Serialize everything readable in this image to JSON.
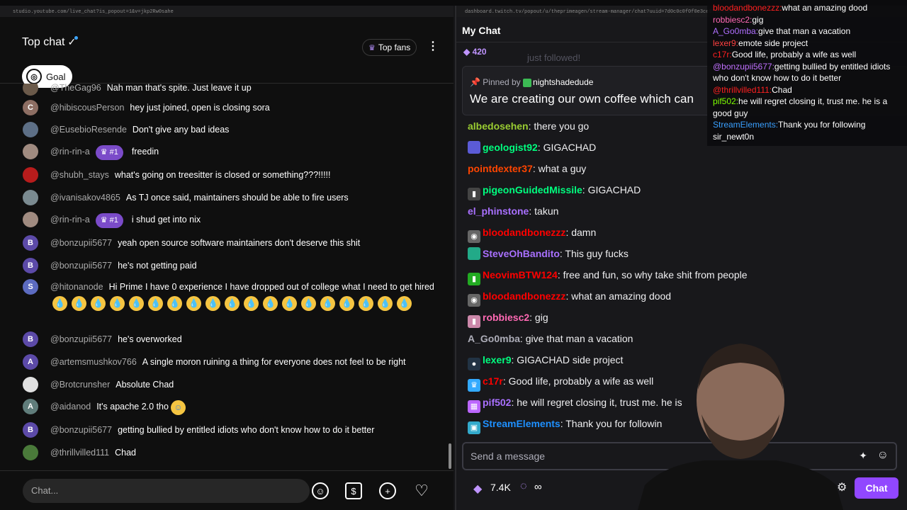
{
  "colors": {
    "yt_bg": "#0f0f0f",
    "twitch_bg": "#18181b",
    "twitch_purple": "#9147ff",
    "yt_badge": "#7b4bc9"
  },
  "youtube": {
    "url": "studio.youtube.com/live_chat?is_popout=1&v=jkp2Rw0sahe",
    "title": "Top chat",
    "top_fans_label": "Top fans",
    "goal_label": "Goal",
    "chat_placeholder": "Chat...",
    "messages": [
      {
        "author": "@TheGag96",
        "text": "Nah man that's spite. Just leave it up",
        "avatar_letter": "",
        "avatar_color": "#6b5a4a"
      },
      {
        "author": "@hibiscousPerson",
        "text": "hey just joined, open is closing sora",
        "avatar_letter": "C",
        "avatar_color": "#8d6e63"
      },
      {
        "author": "@EusebioResende",
        "text": "Don't give any bad ideas",
        "avatar_letter": "",
        "avatar_color": "#5d6f86"
      },
      {
        "author": "@rin-rin-a",
        "badge": "#1",
        "text": "freedin",
        "avatar_letter": "",
        "avatar_color": "#a08b80"
      },
      {
        "author": "@shubh_stays",
        "text": "what's going on treesitter is closed or something???!!!!!",
        "avatar_letter": "",
        "avatar_color": "#b71c1c"
      },
      {
        "author": "@ivanisakov4865",
        "text": "As TJ once said, maintainers should be able to fire users",
        "avatar_letter": "",
        "avatar_color": "#7a8a90"
      },
      {
        "author": "@rin-rin-a",
        "badge": "#1",
        "text": "i shud get into nix",
        "avatar_letter": "",
        "avatar_color": "#a08b80"
      },
      {
        "author": "@bonzupii5677",
        "text": "yeah open source software maintainers don't deserve this shit",
        "avatar_letter": "B",
        "avatar_color": "#5c4aa8"
      },
      {
        "author": "@bonzupii5677",
        "text": "he's not getting paid",
        "avatar_letter": "B",
        "avatar_color": "#5c4aa8"
      },
      {
        "author": "@hitonanode",
        "text": "Hi Prime I have 0 experience I have dropped out of college what I need to get hired",
        "avatar_letter": "S",
        "avatar_color": "#5c6bc0"
      },
      {
        "author": "@bonzupii5677",
        "text": "he's overworked",
        "avatar_letter": "B",
        "avatar_color": "#5c4aa8"
      },
      {
        "author": "@artemsmushkov766",
        "text": "A single moron ruining a thing for everyone does not feel to be right",
        "avatar_letter": "A",
        "avatar_color": "#5c4aa8"
      },
      {
        "author": "@Brotcrunsher",
        "text": "Absolute Chad",
        "avatar_letter": "",
        "avatar_color": "#e0e0e0"
      },
      {
        "author": "@aidanod",
        "text": "It's apache 2.0 tho",
        "avatar_letter": "A",
        "avatar_color": "#607d7b"
      },
      {
        "author": "@bonzupii5677",
        "text": "getting bullied by entitled idiots who don't know how to do it better",
        "avatar_letter": "B",
        "avatar_color": "#5c4aa8"
      },
      {
        "author": "@thrillvilled111",
        "text": "Chad",
        "avatar_letter": "",
        "avatar_color": "#4a7a3a"
      }
    ]
  },
  "twitch": {
    "url": "dashboard.twitch.tv/popout/u/theprimeagen/stream-manager/chat?uuid=7d0c0c0f0f0e3ce0f8d43aa864f7fb05",
    "title": "My Chat",
    "points": "420",
    "followed_text": "just followed!",
    "pinned_by_label": "Pinned by",
    "pinned_by_user": "nightshadedude",
    "pinned_message": "We are creating our own coffee which can",
    "input_placeholder": "Send a message",
    "viewers": "7.4K",
    "infinity": "∞",
    "chat_button": "Chat",
    "messages": [
      {
        "user": "albedosehen",
        "text": ": there you go",
        "color": "#9acd32"
      },
      {
        "user": "geologist92",
        "text": ": GIGACHAD",
        "color": "#00ff7f"
      },
      {
        "user": "pointdexter37",
        "text": ": what a guy",
        "color": "#ff4500"
      },
      {
        "user": "pigeonGuidedMissile",
        "text": ": GIGACHAD",
        "color": "#00ff7f"
      },
      {
        "user": "el_phinstone",
        "text": ": takun",
        "color": "#a970ff"
      },
      {
        "user": "bloodandbonezzz",
        "text": ": damn",
        "color": "#ff0000"
      },
      {
        "user": "SteveOhBandito",
        "text": ": This guy fucks",
        "color": "#a970ff"
      },
      {
        "user": "NeovimBTW124",
        "text": ": free and fun, so why take shit from people",
        "color": "#ff0000"
      },
      {
        "user": "bloodandbonezzz",
        "text": ": what an amazing dood",
        "color": "#ff0000"
      },
      {
        "user": "robbiesc2",
        "text": ": gig",
        "color": "#ff69b4"
      },
      {
        "user": "A_Go0mba",
        "text": ": give that man a vacation",
        "color": "#adadb8"
      },
      {
        "user": "lexer9",
        "text": ": GIGACHAD side project",
        "color": "#00ff7f"
      },
      {
        "user": "c17r",
        "text": ": Good life, probably a wife as well",
        "color": "#ff0000"
      },
      {
        "user": "pif502",
        "text": ": he will regret closing it, trust me. he is",
        "color": "#a970ff"
      },
      {
        "user": "StreamElements",
        "text": ": Thank you for followin",
        "color": "#1e90ff"
      }
    ]
  },
  "overlay": {
    "messages": [
      {
        "user": "bloodandbonezzz:",
        "text": "what an amazing dood",
        "color": "#ff2020"
      },
      {
        "user": "robbiesc2:",
        "text": "gig",
        "color": "#ff69b4"
      },
      {
        "user": "A_Go0mba:",
        "text": "give that man a vacation",
        "color": "#b070ff"
      },
      {
        "user": "lexer9:",
        "text": "emote side project",
        "color": "#ff4040"
      },
      {
        "user": "c17r:",
        "text": "Good life, probably a wife as well",
        "color": "#ff2020"
      },
      {
        "user": "@bonzupii5677:",
        "text": "getting bullied by entitled idiots who don't know how to do it better",
        "color": "#c070ff"
      },
      {
        "user": "@thrillvilled111:",
        "text": "Chad",
        "color": "#ff2020"
      },
      {
        "user": "pif502:",
        "text": "he will regret closing it, trust me. he is a good guy",
        "color": "#7fff00"
      },
      {
        "user": "StreamElements:",
        "text": "Thank you for following sir_newt0n",
        "color": "#3aa0ff"
      }
    ]
  }
}
